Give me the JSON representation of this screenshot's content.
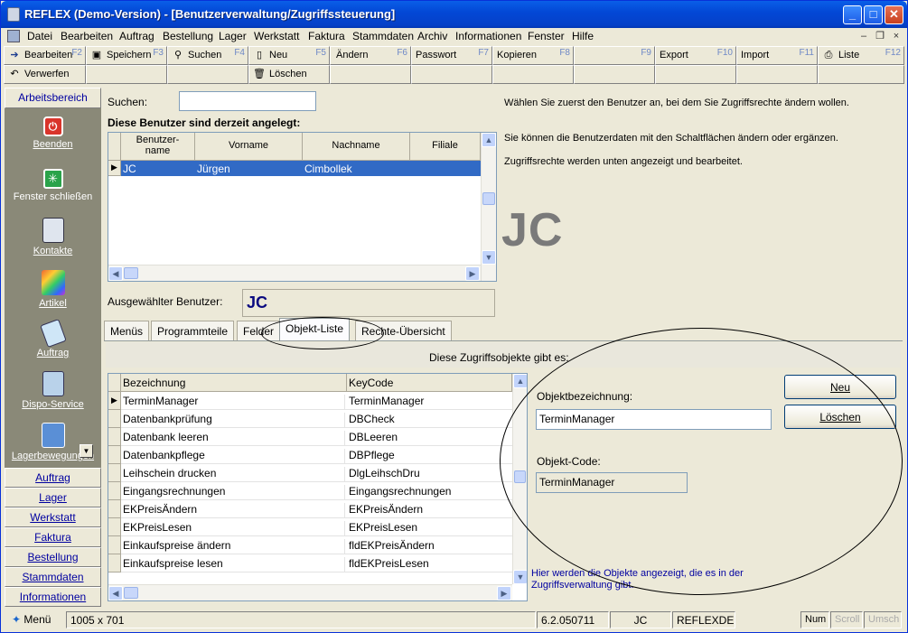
{
  "window": {
    "title": "REFLEX (Demo-Version) - [Benutzerverwaltung/Zugriffssteuerung]"
  },
  "menu": [
    {
      "label": "Datei"
    },
    {
      "label": "Bearbeiten"
    },
    {
      "label": "Auftrag"
    },
    {
      "label": "Bestellung"
    },
    {
      "label": "Lager"
    },
    {
      "label": "Werkstatt"
    },
    {
      "label": "Faktura"
    },
    {
      "label": "Stammdaten"
    },
    {
      "label": "Archiv"
    },
    {
      "label": "Informationen"
    },
    {
      "label": "Fenster"
    },
    {
      "label": "Hilfe"
    }
  ],
  "toolbar": {
    "row1": [
      {
        "label": "Bearbeiten",
        "key": "F2"
      },
      {
        "label": "Speichern",
        "key": "F3"
      },
      {
        "label": "Suchen",
        "key": "F4"
      },
      {
        "label": "Neu",
        "key": "F5"
      },
      {
        "label": "Ändern",
        "key": "F6"
      },
      {
        "label": "Passwort",
        "key": "F7"
      },
      {
        "label": "Kopieren",
        "key": "F8"
      },
      {
        "label": "",
        "key": "F9"
      },
      {
        "label": "Export",
        "key": "F10"
      },
      {
        "label": "Import",
        "key": "F11"
      },
      {
        "label": "Liste",
        "key": "F12"
      }
    ],
    "verwerfen": "Verwerfen",
    "loeschen": "Löschen"
  },
  "sidebar": {
    "header": "Arbeitsbereich",
    "items": [
      {
        "label": "Beenden",
        "icon": "power-icon"
      },
      {
        "label": "Fenster schließen",
        "icon": "close-window-icon"
      },
      {
        "label": "Kontakte",
        "icon": "contacts-icon"
      },
      {
        "label": "Artikel",
        "icon": "article-icon"
      },
      {
        "label": "Auftrag",
        "icon": "order-icon"
      },
      {
        "label": "Dispo-Service",
        "icon": "dispo-icon"
      },
      {
        "label": "Lagerbewegungen",
        "icon": "warehouse-icon"
      }
    ],
    "bottom": [
      "Auftrag",
      "Lager",
      "Werkstatt",
      "Faktura",
      "Bestellung",
      "Stammdaten",
      "Informationen"
    ]
  },
  "users": {
    "search_label": "Suchen:",
    "search_value": "",
    "list_title": "Diese Benutzer sind derzeit angelegt:",
    "columns": [
      "Benutzer-\nname",
      "Vorname",
      "Nachname",
      "Filiale"
    ],
    "rows": [
      {
        "user": "JC",
        "first": "Jürgen",
        "last": "Cimbollek",
        "branch": ""
      }
    ],
    "selected_label": "Ausgewählter Benutzer:",
    "selected_value": "JC"
  },
  "info": {
    "line1": "Wählen Sie zuerst den Benutzer an, bei dem Sie Zugriffsrechte ändern wollen.",
    "line2": "Sie können die Benutzerdaten mit den Schaltflächen ändern oder ergänzen.",
    "line3": "Zugriffsrechte werden unten angezeigt und bearbeitet.",
    "big_initials": "JC"
  },
  "tabs": [
    "Menüs",
    "Programmteile",
    "Felder",
    "Objekt-Liste",
    "Rechte-Übersicht"
  ],
  "objects": {
    "heading": "Diese Zugriffsobjekte gibt es:",
    "columns": [
      "Bezeichnung",
      "KeyCode"
    ],
    "rows": [
      [
        "TerminManager",
        "TerminManager"
      ],
      [
        "Datenbankprüfung",
        "DBCheck"
      ],
      [
        "Datenbank leeren",
        "DBLeeren"
      ],
      [
        "Datenbankpflege",
        "DBPflege"
      ],
      [
        "Leihschein drucken",
        "DlgLeihschDru"
      ],
      [
        "Eingangsrechnungen",
        "Eingangsrechnungen"
      ],
      [
        "EKPreisÄndern",
        "EKPreisÄndern"
      ],
      [
        "EKPreisLesen",
        "EKPreisLesen"
      ],
      [
        "Einkaufspreise ändern",
        "fldEKPreisÄndern"
      ],
      [
        "Einkaufspreise lesen",
        "fldEKPreisLesen"
      ]
    ],
    "name_label": "Objektbezeichnung:",
    "name_value": "TerminManager",
    "code_label": "Objekt-Code:",
    "code_value": "TerminManager",
    "btn_new": "Neu",
    "btn_delete": "Löschen",
    "hint": "Hier werden die Objekte angezeigt, die es in der Zugriffsverwaltung gibt."
  },
  "status": {
    "menu": "Menü",
    "dims": "1005 x 701",
    "version": "6.2.050711",
    "user": "JC",
    "db": "REFLEXDEMO",
    "num": "Num",
    "scroll": "Scroll",
    "umsch": "Umsch"
  }
}
